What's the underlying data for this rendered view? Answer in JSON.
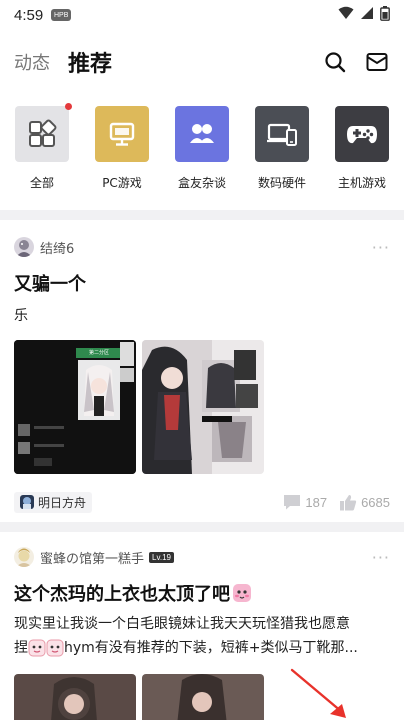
{
  "status_bar": {
    "time": "4:59",
    "chip": "HPB"
  },
  "nav": {
    "tab_dynamic": "动态",
    "tab_recommend": "推荐"
  },
  "categories": [
    {
      "label": "全部",
      "color": "#e3e3e6",
      "icon": "grid-icon"
    },
    {
      "label": "PC游戏",
      "color": "#ddb95a",
      "icon": "monitor-icon"
    },
    {
      "label": "盒友杂谈",
      "color": "#6b74e0",
      "icon": "people-icon"
    },
    {
      "label": "数码硬件",
      "color": "#4b4e55",
      "icon": "devices-icon"
    },
    {
      "label": "主机游戏",
      "color": "#3d3d42",
      "icon": "gamepad-icon"
    }
  ],
  "post1": {
    "author": "结绮6",
    "more": "···",
    "title": "又骗一个",
    "body": "乐",
    "tag": "明日方舟",
    "comments": "187",
    "likes": "6685",
    "screenshot_label": "第二分区"
  },
  "post2": {
    "author": "蜜蜂の馆第一糕手",
    "level": "Lv.19",
    "more": "···",
    "title": "这个杰玛的上衣也太顶了吧",
    "body_line1": "现实里让我谈一个白毛眼镜妹让我天天玩怪猎我也愿意",
    "body_line2_prefix": "捏",
    "body_line2_text": "hym有没有推荐的下装，短裤+类似马丁靴那..."
  },
  "colors": {
    "accent_red": "#e4393c",
    "arrow_red": "#e8322b"
  }
}
